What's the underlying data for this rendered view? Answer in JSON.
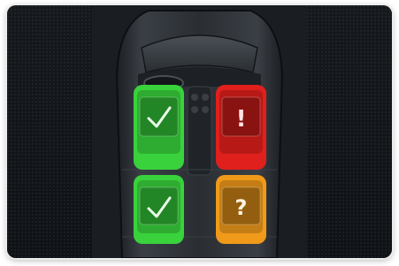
{
  "screen": {
    "background_color": "#1a1e22",
    "car_color": "#2b2f34"
  },
  "seats": [
    {
      "id": "front-left",
      "status": "ok",
      "symbol": "check",
      "color": "#39d23c"
    },
    {
      "id": "front-right",
      "status": "warning",
      "symbol": "!",
      "color": "#e0201c"
    },
    {
      "id": "rear-left",
      "status": "ok",
      "symbol": "check",
      "color": "#39d23c"
    },
    {
      "id": "rear-right",
      "status": "unknown",
      "symbol": "?",
      "color": "#f09a1a"
    }
  ]
}
